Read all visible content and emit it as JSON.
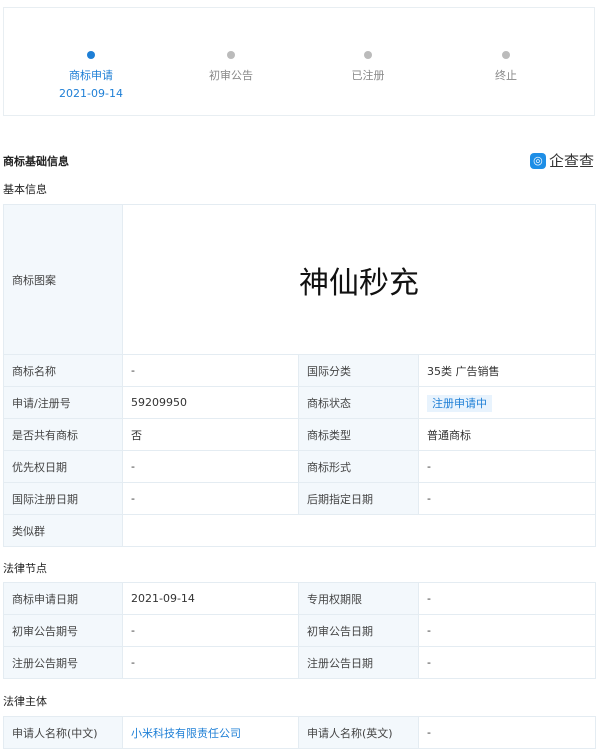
{
  "progress": {
    "steps": [
      {
        "label": "商标申请",
        "date": "2021-09-14"
      },
      {
        "label": "初审公告"
      },
      {
        "label": "已注册"
      },
      {
        "label": "终止"
      }
    ]
  },
  "header": {
    "title": "商标基础信息",
    "logo_text": "企查查"
  },
  "basic": {
    "title": "基本信息",
    "image_label": "商标图案",
    "image_text": "神仙秒充",
    "rows": [
      {
        "l1": "商标名称",
        "v1": "-",
        "l2": "国际分类",
        "v2": "35类 广告销售"
      },
      {
        "l1": "申请/注册号",
        "v1": "59209950",
        "l2": "商标状态",
        "v2": "注册申请中"
      },
      {
        "l1": "是否共有商标",
        "v1": "否",
        "l2": "商标类型",
        "v2": "普通商标"
      },
      {
        "l1": "优先权日期",
        "v1": "-",
        "l2": "商标形式",
        "v2": "-"
      },
      {
        "l1": "国际注册日期",
        "v1": "-",
        "l2": "后期指定日期",
        "v2": "-"
      }
    ],
    "similar_label": "类似群",
    "similar_value": ""
  },
  "legal_nodes": {
    "title": "法律节点",
    "rows": [
      {
        "l1": "商标申请日期",
        "v1": "2021-09-14",
        "l2": "专用权期限",
        "v2": "-"
      },
      {
        "l1": "初审公告期号",
        "v1": "-",
        "l2": "初审公告日期",
        "v2": "-"
      },
      {
        "l1": "注册公告期号",
        "v1": "-",
        "l2": "注册公告日期",
        "v2": "-"
      }
    ]
  },
  "legal_subject": {
    "title": "法律主体",
    "rows": [
      {
        "l1": "申请人名称(中文)",
        "v1": "小米科技有限责任公司",
        "l2": "申请人名称(英文)",
        "v2": "-"
      }
    ]
  },
  "colors": {
    "accent": "#1e7fd6",
    "label_bg": "#f3f8fc"
  }
}
